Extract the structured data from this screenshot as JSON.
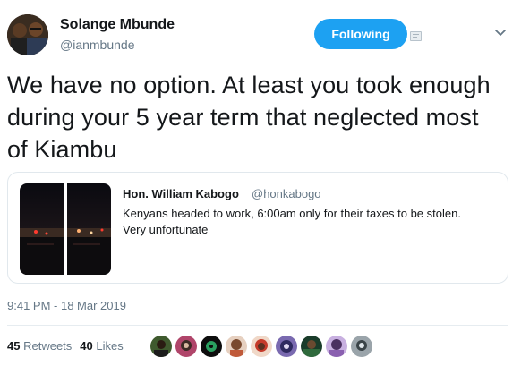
{
  "author": {
    "name": "Solange Mbunde",
    "handle": "@ianmbunde"
  },
  "follow_button": {
    "label": "Following",
    "color": "#1da1f2"
  },
  "tweet": {
    "text_lines": [
      "We have no option. At least you took enough",
      "during your 5 year term that neglected most",
      "of Kiambu"
    ]
  },
  "quoted_tweet": {
    "name": "Hon. William Kabogo",
    "handle": "@honkabogo",
    "text_lines": [
      "Kenyans headed to work, 6:00am only for their taxes to be stolen.",
      "Very unfortunate"
    ]
  },
  "timestamp": "9:41 PM - 18 Mar 2019",
  "stats": {
    "retweets_count": "45",
    "retweets_label": "Retweets",
    "likes_count": "40",
    "likes_label": "Likes"
  },
  "liker_avatars": [
    "avatar-1",
    "avatar-2",
    "avatar-3",
    "avatar-4",
    "avatar-5",
    "avatar-6",
    "avatar-7",
    "avatar-8",
    "avatar-9"
  ],
  "icons": {
    "more": "chevron-down-icon",
    "badge": "caption-badge-icon"
  },
  "colors": {
    "text": "#14171a",
    "secondary": "#657786",
    "border": "#e1e8ed"
  }
}
